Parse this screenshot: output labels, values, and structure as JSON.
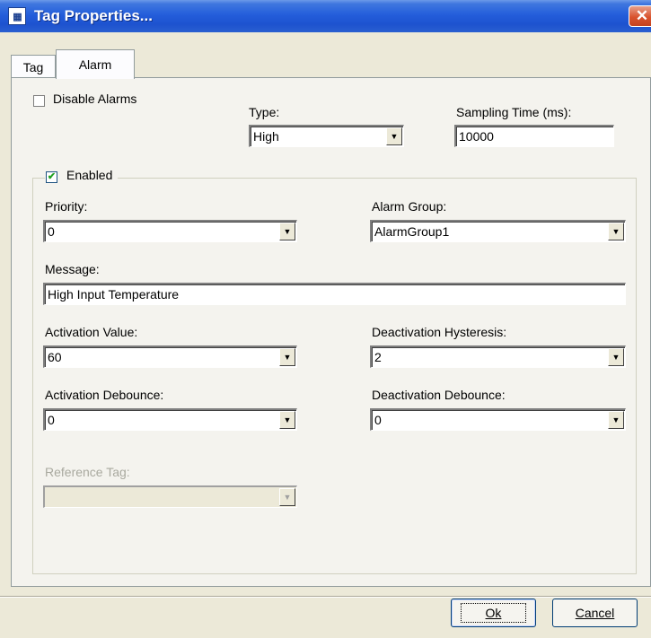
{
  "window": {
    "title": "Tag Properties...",
    "icon": "app-icon",
    "close_label": "✕"
  },
  "tabs": [
    {
      "label": "Tag"
    },
    {
      "label": "Alarm"
    }
  ],
  "alarm": {
    "disable_alarms_label": "Disable Alarms",
    "disable_alarms_checked": false,
    "type_label": "Type:",
    "type_value": "High",
    "sampling_label": "Sampling Time (ms):",
    "sampling_value": "10000",
    "enabled_label": "Enabled",
    "enabled_checked": true,
    "enabled_mark": "✔",
    "priority_label": "Priority:",
    "priority_value": "0",
    "alarm_group_label": "Alarm Group:",
    "alarm_group_value": "AlarmGroup1",
    "message_label": "Message:",
    "message_value": "High Input Temperature",
    "activation_value_label": "Activation Value:",
    "activation_value": "60",
    "deact_hyst_label": "Deactivation Hysteresis:",
    "deact_hyst_value": "2",
    "act_debounce_label": "Activation Debounce:",
    "act_debounce_value": "0",
    "deact_debounce_label": "Deactivation Debounce:",
    "deact_debounce_value": "0",
    "reference_tag_label": "Reference Tag:",
    "reference_tag_value": ""
  },
  "buttons": {
    "ok_label": "Ok",
    "cancel_label": "Cancel"
  },
  "colors": {
    "titlebar": "#245edb",
    "dialog_bg": "#ece9d8",
    "panel_bg": "#f4f3ee"
  }
}
